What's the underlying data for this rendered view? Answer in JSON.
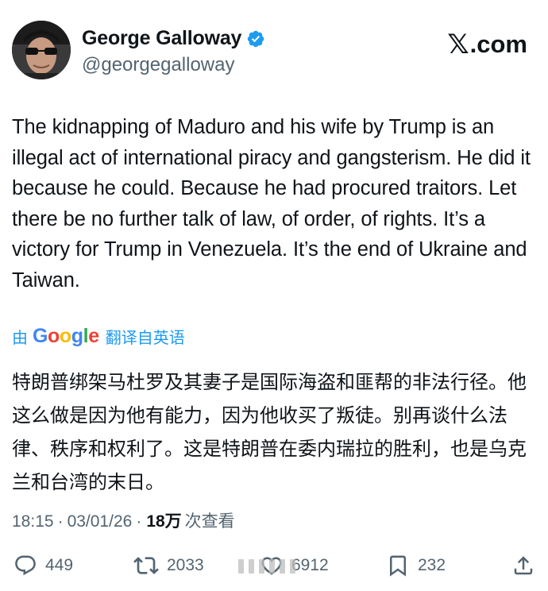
{
  "author": {
    "display_name": "George Galloway",
    "handle": "@georgegalloway",
    "verified": true,
    "avatar_icon": "profile-photo-man-glasses"
  },
  "brand": {
    "text": ".com",
    "icon": "x-logo-icon"
  },
  "tweet": {
    "text_en": "The kidnapping of Maduro and his wife by Trump is an illegal act of international piracy and gangsterism. He did it because he could. Because he had procured traitors. Let there be no further talk of law, of order, of rights. It’s a victory for Trump in Venezuela. It’s the end of Ukraine and Taiwan.",
    "translation": {
      "by_label": "由",
      "provider": "Google",
      "from_label": "翻译自英语"
    },
    "text_zh": "特朗普绑架马杜罗及其妻子是国际海盗和匪帮的非法行径。他这么做是因为他有能力，因为他收买了叛徒。别再谈什么法律、秩序和权利了。这是特朗普在委内瑞拉的胜利，也是乌克兰和台湾的末日。"
  },
  "meta": {
    "time": "18:15",
    "separator": "·",
    "date": "03/01/26",
    "views_count": "18万",
    "views_label": "次查看"
  },
  "actions": {
    "reply_count": "449",
    "repost_count": "2033",
    "like_count": "6912",
    "bookmark_count": "232"
  },
  "colors": {
    "text_primary": "#0f1419",
    "text_secondary": "#536471",
    "accent": "#1d9bf0"
  }
}
